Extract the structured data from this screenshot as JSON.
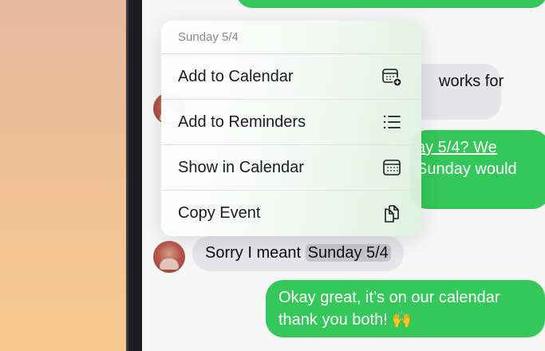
{
  "context_menu": {
    "header": "Sunday 5/4",
    "items": [
      {
        "label": "Add to Calendar",
        "icon": "calendar-add-icon"
      },
      {
        "label": "Add to Reminders",
        "icon": "list-icon"
      },
      {
        "label": "Show in Calendar",
        "icon": "calendar-icon"
      },
      {
        "label": "Copy Event",
        "icon": "copy-icon"
      }
    ]
  },
  "messages": {
    "received_partial": "works for",
    "sent_partial_line1": "ay 5/4? We",
    "sent_partial_line2": "Sunday would",
    "sorry_prefix": "Sorry I meant ",
    "sorry_date": "Sunday 5/4",
    "okay_line1": "Okay great, it’s on our calendar",
    "okay_line2": "thank you both!",
    "okay_emoji": "🙌"
  },
  "colors": {
    "sent_bubble": "#34c759",
    "received_bubble": "#e5e5ea"
  }
}
